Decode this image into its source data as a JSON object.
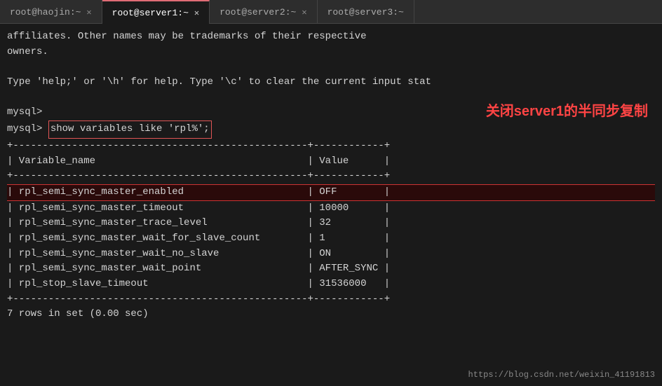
{
  "tabs": [
    {
      "label": "root@haojin:~",
      "active": false
    },
    {
      "label": "root@server1:~",
      "active": true
    },
    {
      "label": "root@server2:~",
      "active": false
    },
    {
      "label": "root@server3:~",
      "active": false
    }
  ],
  "terminal": {
    "lines": [
      "affiliates. Other names may be trademarks of their respective",
      "owners.",
      "",
      "Type 'help;' or '\\h' for help. Type '\\c' to clear the current input stat",
      "",
      "mysql>",
      "mysql> show variables like 'rpl%';"
    ],
    "annotation": "关闭server1的半同步复制",
    "table_sep1": "+--------------------------------------------------+------------+",
    "table_header": "| Variable_name                                    | Value      |",
    "table_sep2": "+--------------------------------------------------+------------+",
    "table_rows": [
      {
        "name": "rpl_semi_sync_master_enabled",
        "value": "OFF",
        "highlighted": true
      },
      {
        "name": "rpl_semi_sync_master_timeout",
        "value": "10000",
        "highlighted": false
      },
      {
        "name": "rpl_semi_sync_master_trace_level",
        "value": "32",
        "highlighted": false
      },
      {
        "name": "rpl_semi_sync_master_wait_for_slave_count",
        "value": "1",
        "highlighted": false
      },
      {
        "name": "rpl_semi_sync_master_wait_no_slave",
        "value": "ON",
        "highlighted": false
      },
      {
        "name": "rpl_semi_sync_master_wait_point",
        "value": "AFTER_SYNC",
        "highlighted": false
      },
      {
        "name": "rpl_stop_slave_timeout",
        "value": "31536000",
        "highlighted": false
      }
    ],
    "table_sep3": "+--------------------------------------------------+------------+",
    "footer": "7 rows in set (0.00 sec)",
    "watermark": "https://blog.csdn.net/weixin_41191813"
  }
}
